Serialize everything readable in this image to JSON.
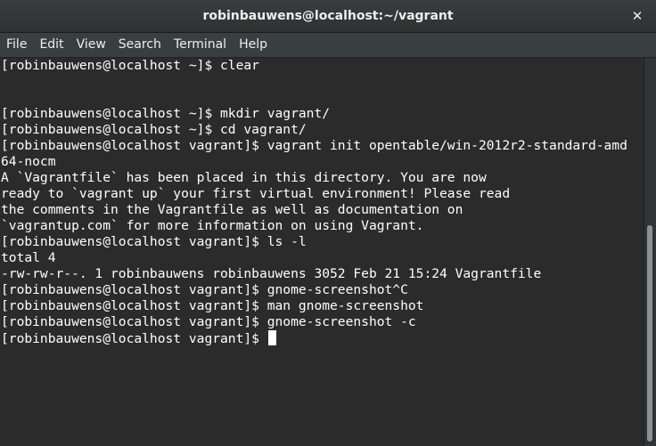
{
  "window": {
    "title": "robinbauwens@localhost:~/vagrant",
    "close_glyph": "✕"
  },
  "menu": {
    "items": [
      "File",
      "Edit",
      "View",
      "Search",
      "Terminal",
      "Help"
    ]
  },
  "terminal": {
    "lines": [
      "[robinbauwens@localhost ~]$ clear",
      "",
      "",
      "[robinbauwens@localhost ~]$ mkdir vagrant/",
      "[robinbauwens@localhost ~]$ cd vagrant/",
      "[robinbauwens@localhost vagrant]$ vagrant init opentable/win-2012r2-standard-amd",
      "64-nocm",
      "A `Vagrantfile` has been placed in this directory. You are now",
      "ready to `vagrant up` your first virtual environment! Please read",
      "the comments in the Vagrantfile as well as documentation on",
      "`vagrantup.com` for more information on using Vagrant.",
      "[robinbauwens@localhost vagrant]$ ls -l",
      "total 4",
      "-rw-rw-r--. 1 robinbauwens robinbauwens 3052 Feb 21 15:24 Vagrantfile",
      "[robinbauwens@localhost vagrant]$ gnome-screenshot^C",
      "[robinbauwens@localhost vagrant]$ man gnome-screenshot",
      "[robinbauwens@localhost vagrant]$ gnome-screenshot -c"
    ],
    "prompt": "[robinbauwens@localhost vagrant]$ "
  },
  "colors": {
    "background": "#2b2b2b",
    "foreground": "#ffffff",
    "titlebar": "#353738",
    "menubar": "#393f3f"
  }
}
